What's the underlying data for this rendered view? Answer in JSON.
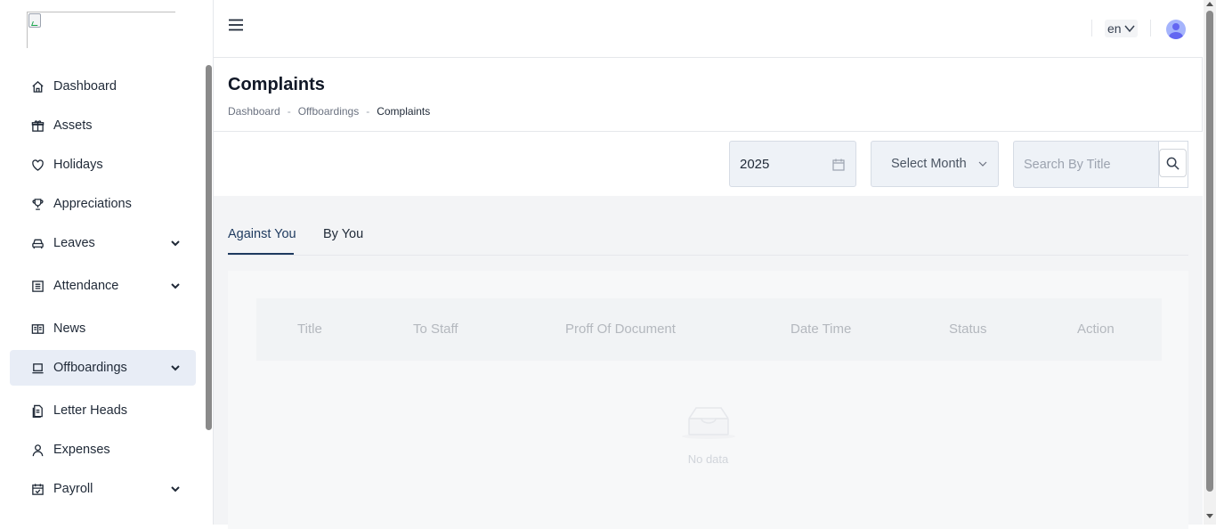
{
  "sidebar": {
    "items": [
      {
        "label": "Dashboard",
        "icon": "home-icon"
      },
      {
        "label": "Assets",
        "icon": "gift-icon"
      },
      {
        "label": "Holidays",
        "icon": "heart-icon"
      },
      {
        "label": "Appreciations",
        "icon": "trophy-icon"
      },
      {
        "label": "Leaves",
        "icon": "car-icon",
        "expandable": true
      },
      {
        "label": "Attendance",
        "icon": "list-icon",
        "expandable": true
      },
      {
        "label": "News",
        "icon": "newspaper-icon"
      },
      {
        "label": "Offboardings",
        "icon": "laptop-icon",
        "expandable": true,
        "active": true
      },
      {
        "label": "Letter Heads",
        "icon": "document-icon"
      },
      {
        "label": "Expenses",
        "icon": "user-icon"
      },
      {
        "label": "Payroll",
        "icon": "calendar-check-icon",
        "expandable": true
      }
    ]
  },
  "header": {
    "language": "en"
  },
  "page": {
    "title": "Complaints",
    "breadcrumb": [
      "Dashboard",
      "Offboardings",
      "Complaints"
    ],
    "breadcrumb_separator": "-"
  },
  "filters": {
    "year_value": "2025",
    "month_placeholder": "Select Month",
    "search_placeholder": "Search By Title"
  },
  "tabs": [
    {
      "label": "Against You",
      "active": true
    },
    {
      "label": "By You",
      "active": false
    }
  ],
  "table": {
    "columns": [
      "Title",
      "To Staff",
      "Proff Of Document",
      "Date Time",
      "Status",
      "Action"
    ],
    "rows": [],
    "empty_text": "No data"
  },
  "colors": {
    "active_nav_bg": "#e8edf6",
    "accent": "#1e3a5f",
    "input_bg": "#eef2f7",
    "content_bg": "#f3f4f6"
  }
}
